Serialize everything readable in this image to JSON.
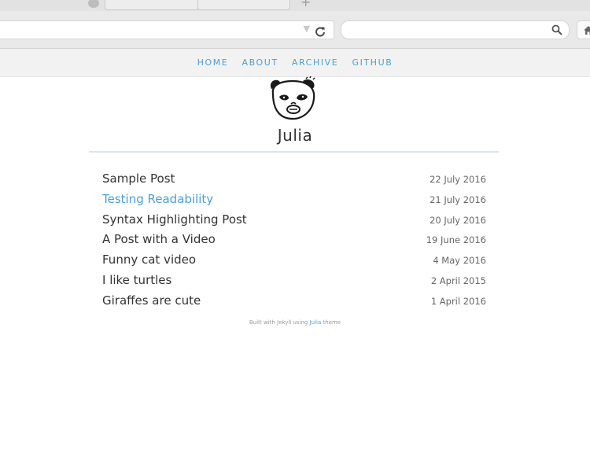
{
  "browser": {
    "new_tab_glyph": "+",
    "url_dropdown_glyph": "▼",
    "reload_glyph": "C",
    "search_icon": "search-icon",
    "home_icon": "home-icon"
  },
  "nav": {
    "items": [
      {
        "label": "HOME"
      },
      {
        "label": "ABOUT"
      },
      {
        "label": "ARCHIVE"
      },
      {
        "label": "GITHUB"
      }
    ]
  },
  "header": {
    "avatar_icon": "panda-avatar",
    "title": "Julia"
  },
  "posts": [
    {
      "title": "Sample Post",
      "date": "22 July 2016"
    },
    {
      "title": "Testing Readability",
      "date": "21 July 2016"
    },
    {
      "title": "Syntax Highlighting Post",
      "date": "20 July 2016"
    },
    {
      "title": "A Post with a Video",
      "date": "19 June 2016"
    },
    {
      "title": "Funny cat video",
      "date": "4 May 2016"
    },
    {
      "title": "I like turtles",
      "date": "2 April 2015"
    },
    {
      "title": "Giraffes are cute",
      "date": "1 April 2016"
    }
  ],
  "footer": {
    "prefix": "Built with Jekyll using ",
    "link": "Julia",
    "suffix": " theme"
  },
  "colors": {
    "accent": "#4aa0d5",
    "text": "#333333",
    "rule": "#d7e6f4"
  }
}
